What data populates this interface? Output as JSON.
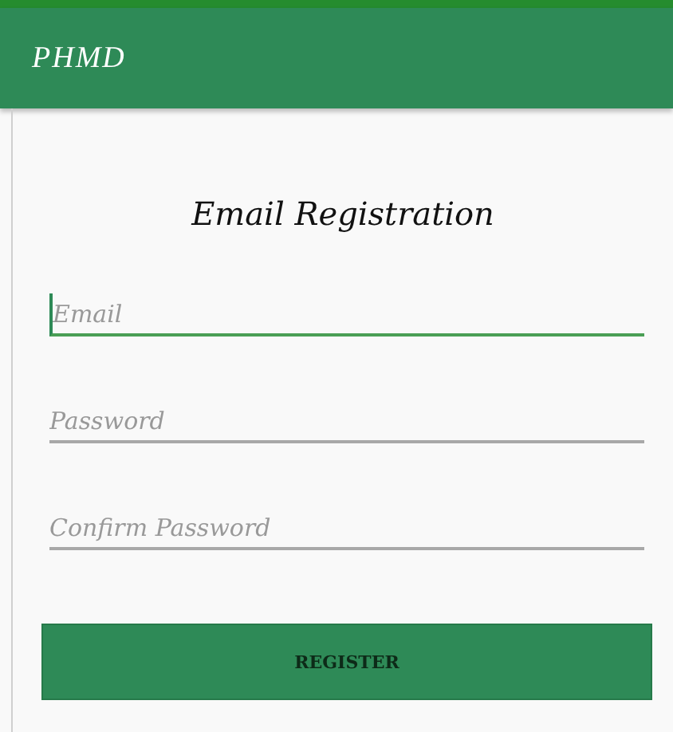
{
  "app_bar": {
    "title": "PHMD"
  },
  "heading": "Email Registration",
  "fields": [
    {
      "placeholder": "Email",
      "focused": true
    },
    {
      "placeholder": "Password",
      "focused": false
    },
    {
      "placeholder": "Confirm Password",
      "focused": false
    }
  ],
  "button": "REGISTER"
}
